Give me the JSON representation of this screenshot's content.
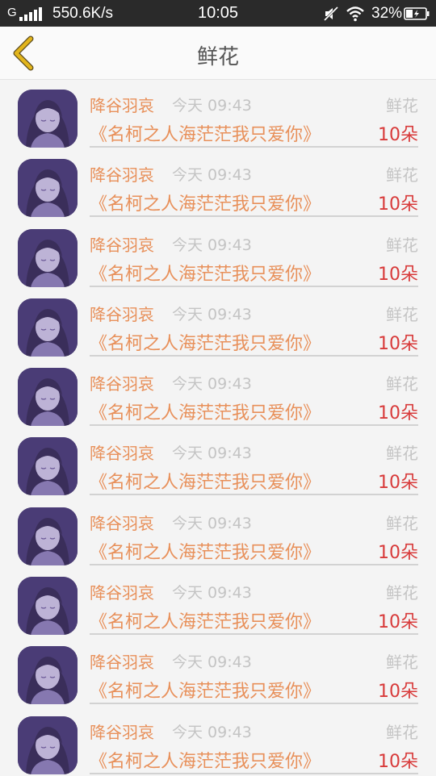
{
  "status_bar": {
    "carrier": "G",
    "network_speed": "550.6K/s",
    "time": "10:05",
    "battery": "32%"
  },
  "header": {
    "title": "鲜花"
  },
  "records": [
    {
      "username": "降谷羽哀",
      "time": "今天 09:43",
      "gift_type": "鲜花",
      "book_title": "《名柯之人海茫茫我只爱你》",
      "quantity": "10朵"
    },
    {
      "username": "降谷羽哀",
      "time": "今天 09:43",
      "gift_type": "鲜花",
      "book_title": "《名柯之人海茫茫我只爱你》",
      "quantity": "10朵"
    },
    {
      "username": "降谷羽哀",
      "time": "今天 09:43",
      "gift_type": "鲜花",
      "book_title": "《名柯之人海茫茫我只爱你》",
      "quantity": "10朵"
    },
    {
      "username": "降谷羽哀",
      "time": "今天 09:43",
      "gift_type": "鲜花",
      "book_title": "《名柯之人海茫茫我只爱你》",
      "quantity": "10朵"
    },
    {
      "username": "降谷羽哀",
      "time": "今天 09:43",
      "gift_type": "鲜花",
      "book_title": "《名柯之人海茫茫我只爱你》",
      "quantity": "10朵"
    },
    {
      "username": "降谷羽哀",
      "time": "今天 09:43",
      "gift_type": "鲜花",
      "book_title": "《名柯之人海茫茫我只爱你》",
      "quantity": "10朵"
    },
    {
      "username": "降谷羽哀",
      "time": "今天 09:43",
      "gift_type": "鲜花",
      "book_title": "《名柯之人海茫茫我只爱你》",
      "quantity": "10朵"
    },
    {
      "username": "降谷羽哀",
      "time": "今天 09:43",
      "gift_type": "鲜花",
      "book_title": "《名柯之人海茫茫我只爱你》",
      "quantity": "10朵"
    },
    {
      "username": "降谷羽哀",
      "time": "今天 09:43",
      "gift_type": "鲜花",
      "book_title": "《名柯之人海茫茫我只爱你》",
      "quantity": "10朵"
    },
    {
      "username": "降谷羽哀",
      "time": "今天 09:43",
      "gift_type": "鲜花",
      "book_title": "《名柯之人海茫茫我只爱你》",
      "quantity": "10朵"
    }
  ],
  "colors": {
    "accent": "#e8905a",
    "quantity": "#d83a3a",
    "muted": "#c4c4c4",
    "back_arrow": "#e2b51c"
  },
  "icons": {
    "back": "back-arrow-icon",
    "avatar": "avatar-image",
    "status": [
      "signal-icon",
      "mute-icon",
      "wifi-icon",
      "battery-icon"
    ]
  }
}
